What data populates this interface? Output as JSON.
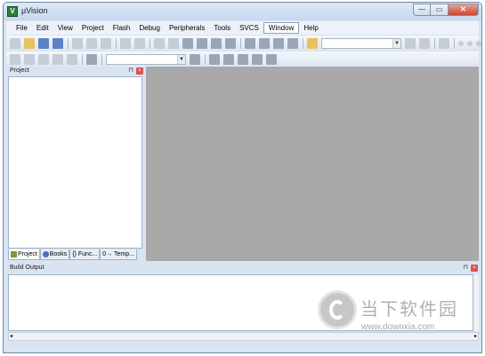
{
  "window": {
    "title": "µVision",
    "minimize": "—",
    "maximize": "▭",
    "close": "✕"
  },
  "menu": [
    {
      "label": "File"
    },
    {
      "label": "Edit"
    },
    {
      "label": "View"
    },
    {
      "label": "Project"
    },
    {
      "label": "Flash"
    },
    {
      "label": "Debug"
    },
    {
      "label": "Peripherals"
    },
    {
      "label": "Tools"
    },
    {
      "label": "SVCS"
    },
    {
      "label": "Window"
    },
    {
      "label": "Help"
    }
  ],
  "project_panel": {
    "title": "Project",
    "pin": "⊓",
    "close": "×",
    "tabs": [
      {
        "label": "Project",
        "icon": "project-tab-icon"
      },
      {
        "label": "Books",
        "icon": "books-tab-icon"
      },
      {
        "label": "{} Func...",
        "icon": "functions-tab-icon"
      },
      {
        "label": "0→ Temp...",
        "icon": "templates-tab-icon"
      }
    ]
  },
  "build_output": {
    "title": "Build Output",
    "pin": "⊓",
    "close": "×"
  },
  "scroll": {
    "left": "◂",
    "right": "▸"
  },
  "watermark": {
    "name": "当下软件园",
    "url": "www.downxia.com"
  },
  "colors": {
    "editor_background": "#a9a9a9",
    "window_frame": "#d8e4f2",
    "close_button": "#c9462f"
  }
}
